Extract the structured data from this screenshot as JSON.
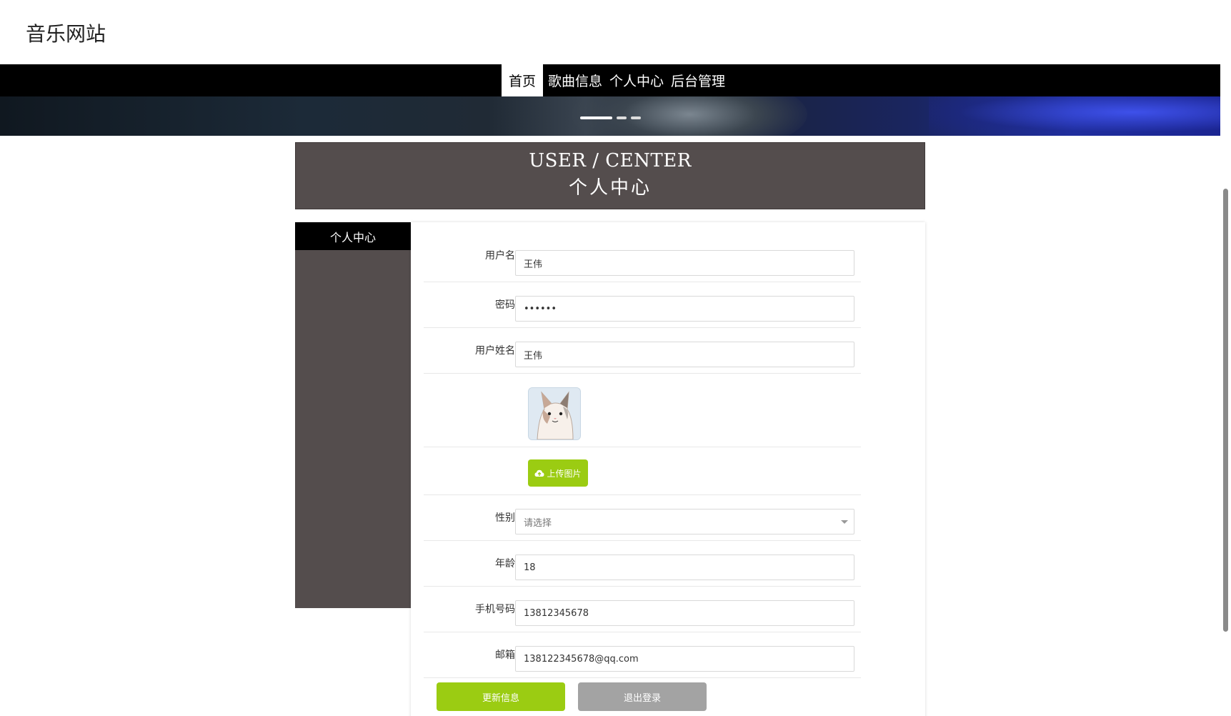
{
  "header": {
    "site_title": "音乐网站"
  },
  "nav": {
    "items": [
      "首页",
      "歌曲信息",
      "个人中心",
      "后台管理"
    ],
    "active_index": 0
  },
  "center_title": {
    "en": "USER / CENTER",
    "cn": "个人中心"
  },
  "sidebar": {
    "items": [
      "个人中心"
    ]
  },
  "form": {
    "username": {
      "label": "用户名",
      "value": "王伟"
    },
    "password": {
      "label": "密码",
      "value": "••••••"
    },
    "real_name": {
      "label": "用户姓名",
      "value": "王伟"
    },
    "upload_label": "上传图片",
    "gender": {
      "label": "性别",
      "placeholder": "请选择"
    },
    "age": {
      "label": "年龄",
      "value": "18"
    },
    "phone": {
      "label": "手机号码",
      "value": "13812345678"
    },
    "email": {
      "label": "邮箱",
      "value": "138122345678@qq.com"
    }
  },
  "buttons": {
    "update": "更新信息",
    "logout": "退出登录"
  },
  "colors": {
    "accent_green": "#9bcc12",
    "panel_dark": "#544d4d",
    "nav_black": "#000000",
    "logout_gray": "#a3a3a3"
  },
  "icons": {
    "upload": "cloud-upload-icon",
    "select": "chevron-down-icon"
  }
}
